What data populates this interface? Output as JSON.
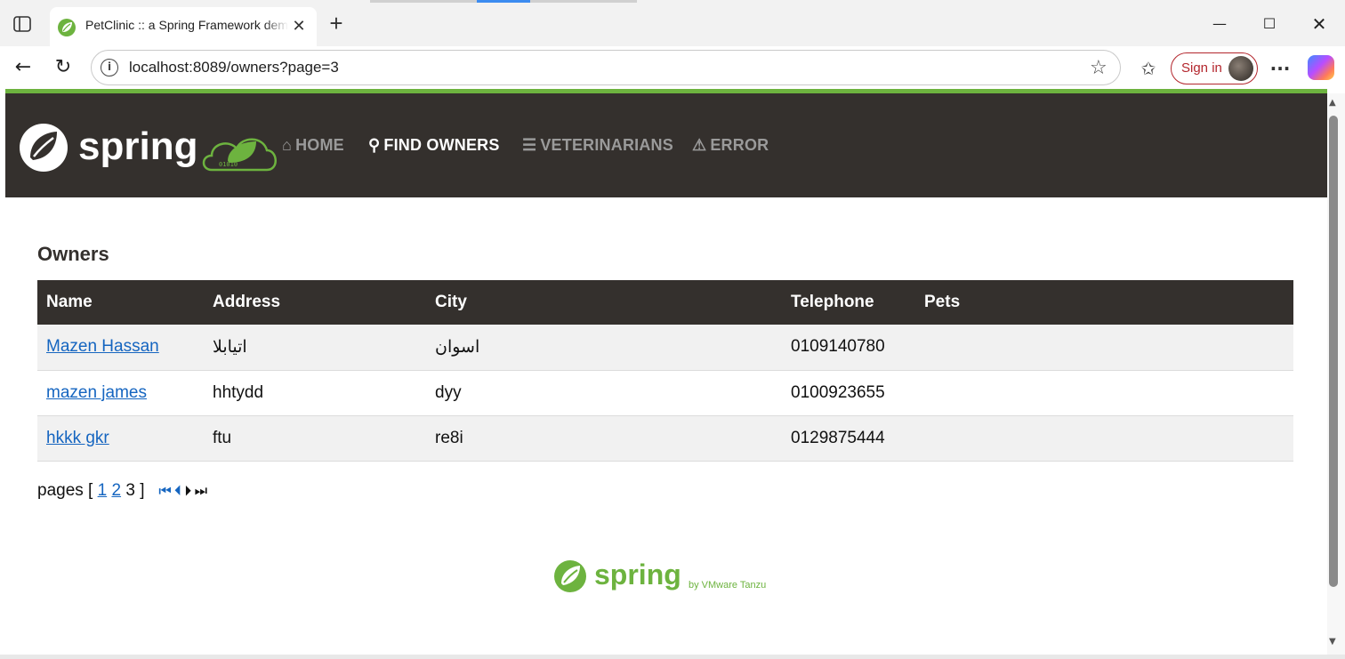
{
  "browser": {
    "tab_title": "PetClinic :: a Spring Framework demonstration",
    "url": "localhost:8089/owners?page=3",
    "sign_in_label": "Sign in",
    "icons": {
      "sidebar": "sidebar-toggle-icon",
      "favicon": "spring-leaf-icon",
      "close": "close-icon",
      "new_tab": "plus-icon",
      "back": "back-arrow-icon",
      "refresh": "refresh-icon",
      "info": "info-icon",
      "favorite": "star-icon",
      "favorites": "favorites-list-icon",
      "more": "more-icon",
      "copilot": "copilot-icon"
    }
  },
  "navbar": {
    "brand": "spring",
    "items": [
      {
        "label": "HOME",
        "icon": "home-icon",
        "active": false
      },
      {
        "label": "FIND OWNERS",
        "icon": "search-icon",
        "active": true
      },
      {
        "label": "VETERINARIANS",
        "icon": "list-icon",
        "active": false
      },
      {
        "label": "ERROR",
        "icon": "warning-icon",
        "active": false
      }
    ]
  },
  "page": {
    "title": "Owners",
    "table": {
      "columns": [
        "Name",
        "Address",
        "City",
        "Telephone",
        "Pets"
      ],
      "rows": [
        {
          "name": "Mazen Hassan",
          "address": "اتيابلا",
          "city": "اسوان",
          "telephone": "0109140780",
          "pets": ""
        },
        {
          "name": "mazen james",
          "address": "hhtydd",
          "city": "dyy",
          "telephone": "0100923655",
          "pets": ""
        },
        {
          "name": "hkkk gkr",
          "address": "ftu",
          "city": "re8i",
          "telephone": "0129875444",
          "pets": ""
        }
      ]
    },
    "pagination": {
      "prefix": "pages [",
      "pages": [
        "1",
        "2"
      ],
      "current": "3",
      "suffix": "]"
    }
  },
  "footer": {
    "brand": "spring",
    "tagline": "by VMware Tanzu"
  },
  "colors": {
    "spring_green": "#6db33f",
    "navbar_bg": "#34302d",
    "link": "#1565c0"
  }
}
